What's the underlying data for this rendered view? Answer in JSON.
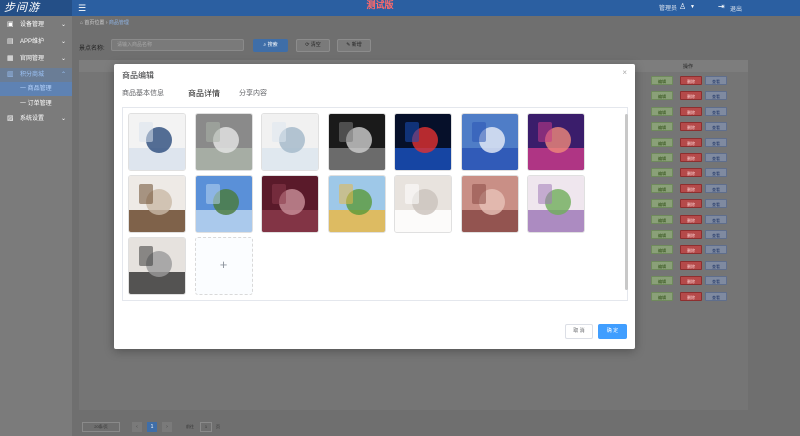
{
  "app": {
    "logo_text": "步间游",
    "title": "测试版",
    "user_name": "管理员",
    "logout_label": "退出"
  },
  "sidebar": {
    "items": [
      {
        "label": "设备管理",
        "icon": "device-icon"
      },
      {
        "label": "APP维护",
        "icon": "app-icon"
      },
      {
        "label": "官网管理",
        "icon": "website-icon"
      },
      {
        "label": "积分商城",
        "icon": "mall-icon"
      },
      {
        "label": "系统设置",
        "icon": "settings-icon"
      }
    ],
    "subitems": [
      {
        "label": "一 商品管理"
      },
      {
        "label": "一 订单管理"
      }
    ]
  },
  "breadcrumb": {
    "home": "首页位置",
    "separator": "›",
    "current": "商品管理"
  },
  "filter": {
    "label": "景点名称:",
    "placeholder": "请输入商品名称",
    "search_label": "搜索",
    "clear_label": "清空",
    "add_label": "新增"
  },
  "table": {
    "operations_header": "操作",
    "row_count": 15,
    "edit_label": "编辑",
    "delete_label": "删除",
    "view_label": "查看"
  },
  "pagination": {
    "page_size": "20条/页",
    "current_page": "1",
    "goto_label": "前往",
    "goto_value": "1",
    "page_unit": "页"
  },
  "modal": {
    "title": "商品编辑",
    "tabs": [
      "商品基本信息",
      "商品详情",
      "分享内容"
    ],
    "active_tab": 1,
    "images": [
      {
        "name": "lab-researcher-image",
        "colors": [
          "#f3f3f3",
          "#d9e2ec",
          "#2a4b7c"
        ]
      },
      {
        "name": "eco-bag-image",
        "colors": [
          "#8a8a8a",
          "#aab3a8",
          "#e6e6e6"
        ]
      },
      {
        "name": "lab-scientist-image",
        "colors": [
          "#f1f1f1",
          "#dde6ee",
          "#a3b8c9"
        ]
      },
      {
        "name": "abstract-dark-wave-image",
        "colors": [
          "#1a1a1a",
          "#7a7a7a",
          "#d0d0d0"
        ]
      },
      {
        "name": "blue-car-light-image",
        "colors": [
          "#06102a",
          "#1a4fb8",
          "#e23131"
        ]
      },
      {
        "name": "company-building-sign-image",
        "colors": [
          "#4f7dc7",
          "#2b55b5",
          "#e8eef7"
        ]
      },
      {
        "name": "sengled-purple-image",
        "colors": [
          "#3a1d6b",
          "#c43a88",
          "#f08a7a"
        ]
      },
      {
        "name": "rocking-chair-image",
        "colors": [
          "#eeeae6",
          "#6b4a2e",
          "#c9b9a6"
        ]
      },
      {
        "name": "factory-landscape-image",
        "colors": [
          "#5a90d8",
          "#b8d3f0",
          "#4a7a3a"
        ]
      },
      {
        "name": "chip-product-image",
        "colors": [
          "#5a1a2a",
          "#8a3a4a",
          "#c9909a"
        ]
      },
      {
        "name": "child-outdoor-image",
        "colors": [
          "#9ec8e8",
          "#e8b84a",
          "#5a9a3a"
        ]
      },
      {
        "name": "white-device-image",
        "colors": [
          "#e8e3de",
          "#ffffff",
          "#c9c2bb"
        ]
      },
      {
        "name": "fabric-woman-image",
        "colors": [
          "#c98f86",
          "#8a4a46",
          "#e8c2b8"
        ]
      },
      {
        "name": "cosmetics-bottles-image",
        "colors": [
          "#efe6ee",
          "#a07ab8",
          "#6fae5a"
        ]
      },
      {
        "name": "drone-image",
        "colors": [
          "#e6e2de",
          "#3a3a3a",
          "#9a9a9a"
        ]
      }
    ],
    "cancel_label": "取 消",
    "confirm_label": "确 定"
  },
  "colors": {
    "topbar": "#2b5fa1",
    "primary": "#409eff",
    "danger": "#b54a4a",
    "title_red": "#ff6a6a"
  }
}
